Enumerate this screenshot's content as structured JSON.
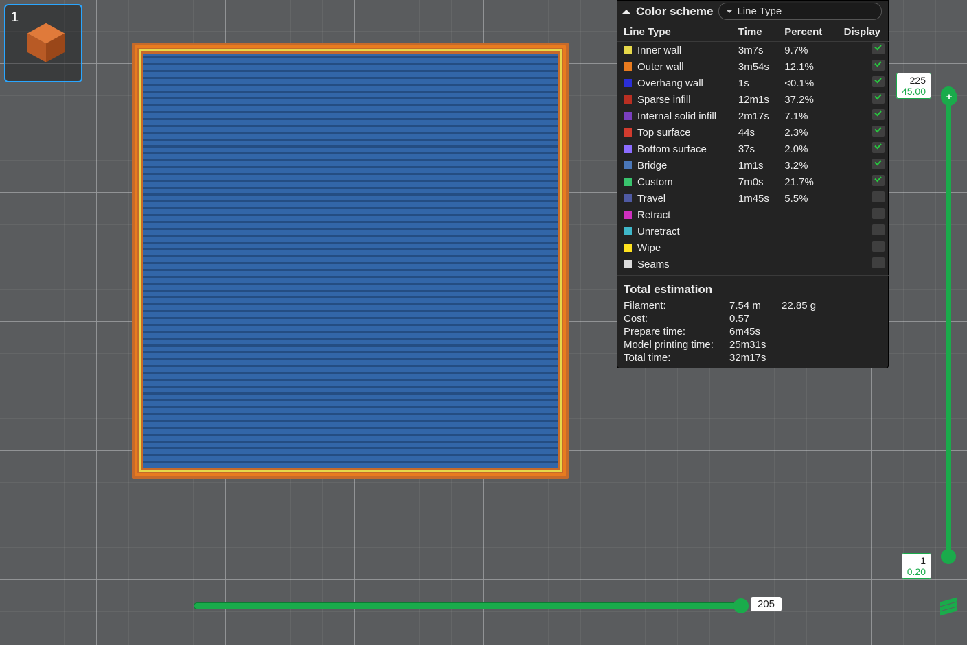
{
  "thumb": {
    "index": "1"
  },
  "panel": {
    "title": "Color scheme",
    "scheme": "Line Type",
    "columns": {
      "c1": "Line Type",
      "c2": "Time",
      "c3": "Percent",
      "c4": "Display"
    },
    "rows": [
      {
        "color": "#e6d84a",
        "name": "Inner wall",
        "time": "3m7s",
        "pct": "9.7%",
        "chk": true
      },
      {
        "color": "#e87b1f",
        "name": "Outer wall",
        "time": "3m54s",
        "pct": "12.1%",
        "chk": true
      },
      {
        "color": "#2a2ed6",
        "name": "Overhang wall",
        "time": "1s",
        "pct": "<0.1%",
        "chk": true
      },
      {
        "color": "#b92f22",
        "name": "Sparse infill",
        "time": "12m1s",
        "pct": "37.2%",
        "chk": true
      },
      {
        "color": "#7a3fbf",
        "name": "Internal solid infill",
        "time": "2m17s",
        "pct": "7.1%",
        "chk": true
      },
      {
        "color": "#d23b2e",
        "name": "Top surface",
        "time": "44s",
        "pct": "2.3%",
        "chk": true
      },
      {
        "color": "#8c6cff",
        "name": "Bottom surface",
        "time": "37s",
        "pct": "2.0%",
        "chk": true
      },
      {
        "color": "#4a77b8",
        "name": "Bridge",
        "time": "1m1s",
        "pct": "3.2%",
        "chk": true
      },
      {
        "color": "#39c36d",
        "name": "Custom",
        "time": "7m0s",
        "pct": "21.7%",
        "chk": true
      },
      {
        "color": "#4f5aa3",
        "name": "Travel",
        "time": "1m45s",
        "pct": "5.5%",
        "chk": false
      },
      {
        "color": "#cf2fbf",
        "name": "Retract",
        "time": "",
        "pct": "",
        "chk": false
      },
      {
        "color": "#3fb7c9",
        "name": "Unretract",
        "time": "",
        "pct": "",
        "chk": false
      },
      {
        "color": "#ffe21f",
        "name": "Wipe",
        "time": "",
        "pct": "",
        "chk": false
      },
      {
        "color": "#dcdcdc",
        "name": "Seams",
        "time": "",
        "pct": "",
        "chk": false
      }
    ],
    "total_title": "Total estimation",
    "totals": {
      "filament_k": "Filament:",
      "filament_v1": "7.54 m",
      "filament_v2": "22.85 g",
      "cost_k": "Cost:",
      "cost_v1": "0.57",
      "prep_k": "Prepare time:",
      "prep_v1": "6m45s",
      "print_k": "Model printing time:",
      "print_v1": "25m31s",
      "total_k": "Total time:",
      "total_v1": "32m17s"
    }
  },
  "hslider": {
    "value": "205"
  },
  "vslider": {
    "top_layer": "225",
    "top_mm": "45.00",
    "bot_layer": "1",
    "bot_mm": "0.20"
  }
}
